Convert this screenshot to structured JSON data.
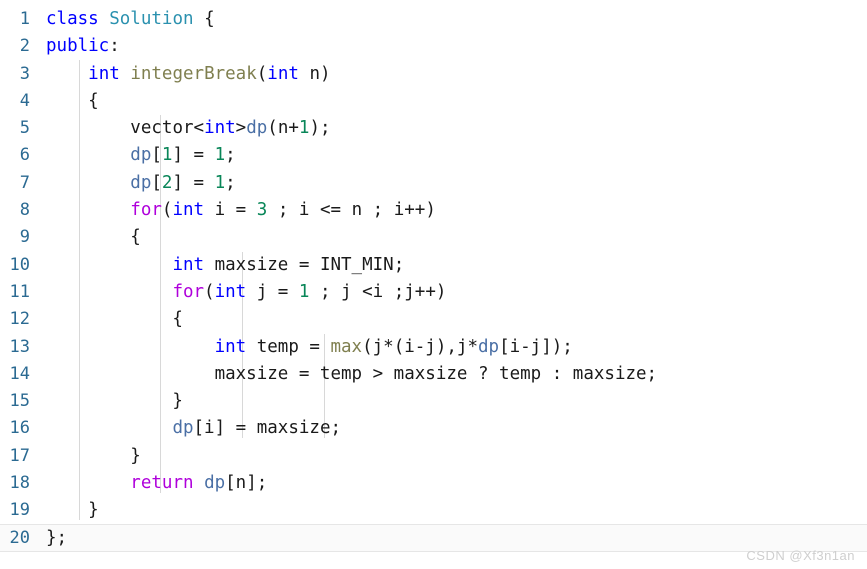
{
  "editor": {
    "language": "cpp",
    "first_line": 1,
    "last_line": 20,
    "colors": {
      "background": "#ffffff",
      "line_number": "#2b6a92",
      "keyword": "#0000ff",
      "control_keyword": "#af00db",
      "class_name": "#2b91af",
      "function_name": "#7f7f4f",
      "variable": "#4a6fa5",
      "number": "#098658",
      "default_text": "#1a1a1a",
      "indent_guide": "#d8d8d8",
      "active_line": "#fafafa",
      "watermark": "#cfcfcf"
    },
    "line_numbers": [
      "1",
      "2",
      "3",
      "4",
      "5",
      "6",
      "7",
      "8",
      "9",
      "10",
      "11",
      "12",
      "13",
      "14",
      "15",
      "16",
      "17",
      "18",
      "19",
      "20"
    ],
    "lines": [
      {
        "n": "1",
        "text": "class Solution {"
      },
      {
        "n": "2",
        "text": "public:"
      },
      {
        "n": "3",
        "text": "    int integerBreak(int n)"
      },
      {
        "n": "4",
        "text": "    {"
      },
      {
        "n": "5",
        "text": "        vector<int>dp(n+1);"
      },
      {
        "n": "6",
        "text": "        dp[1] = 1;"
      },
      {
        "n": "7",
        "text": "        dp[2] = 1;"
      },
      {
        "n": "8",
        "text": "        for(int i = 3 ; i <= n ; i++)"
      },
      {
        "n": "9",
        "text": "        {"
      },
      {
        "n": "10",
        "text": "            int maxsize = INT_MIN;"
      },
      {
        "n": "11",
        "text": "            for(int j = 1 ; j <i ;j++)"
      },
      {
        "n": "12",
        "text": "            {"
      },
      {
        "n": "13",
        "text": "                int temp = max(j*(i-j),j*dp[i-j]);"
      },
      {
        "n": "14",
        "text": "                maxsize = temp > maxsize ? temp : maxsize;"
      },
      {
        "n": "15",
        "text": "            }"
      },
      {
        "n": "16",
        "text": "            dp[i] = maxsize;"
      },
      {
        "n": "17",
        "text": "        }"
      },
      {
        "n": "18",
        "text": "        return dp[n];"
      },
      {
        "n": "19",
        "text": "    }"
      },
      {
        "n": "20",
        "text": "};"
      }
    ]
  },
  "watermark": {
    "text": "CSDN @Xf3n1an"
  }
}
